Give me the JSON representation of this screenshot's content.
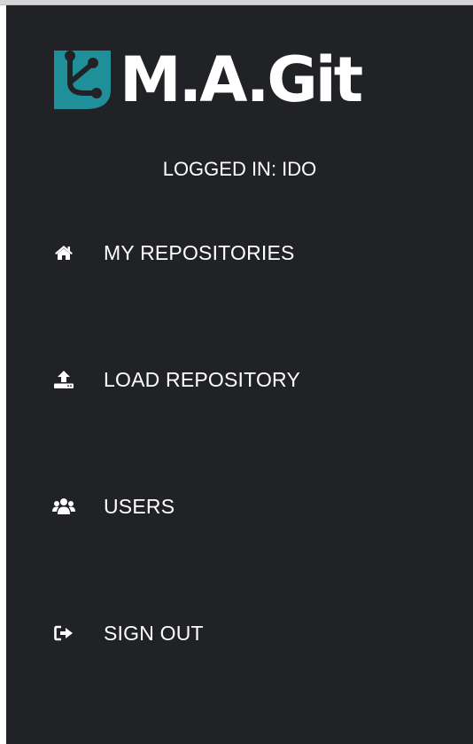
{
  "app": {
    "logo_text": "M.A.Git",
    "accent_color": "#1f8f9a",
    "sidebar_color": "#212226"
  },
  "user": {
    "logged_in_label": "LOGGED IN: IDO"
  },
  "menu": {
    "items": [
      {
        "label": "MY REPOSITORIES",
        "icon": "home-icon"
      },
      {
        "label": "LOAD REPOSITORY",
        "icon": "upload-icon"
      },
      {
        "label": "USERS",
        "icon": "users-icon"
      },
      {
        "label": "SIGN OUT",
        "icon": "sign-out-icon"
      }
    ]
  }
}
